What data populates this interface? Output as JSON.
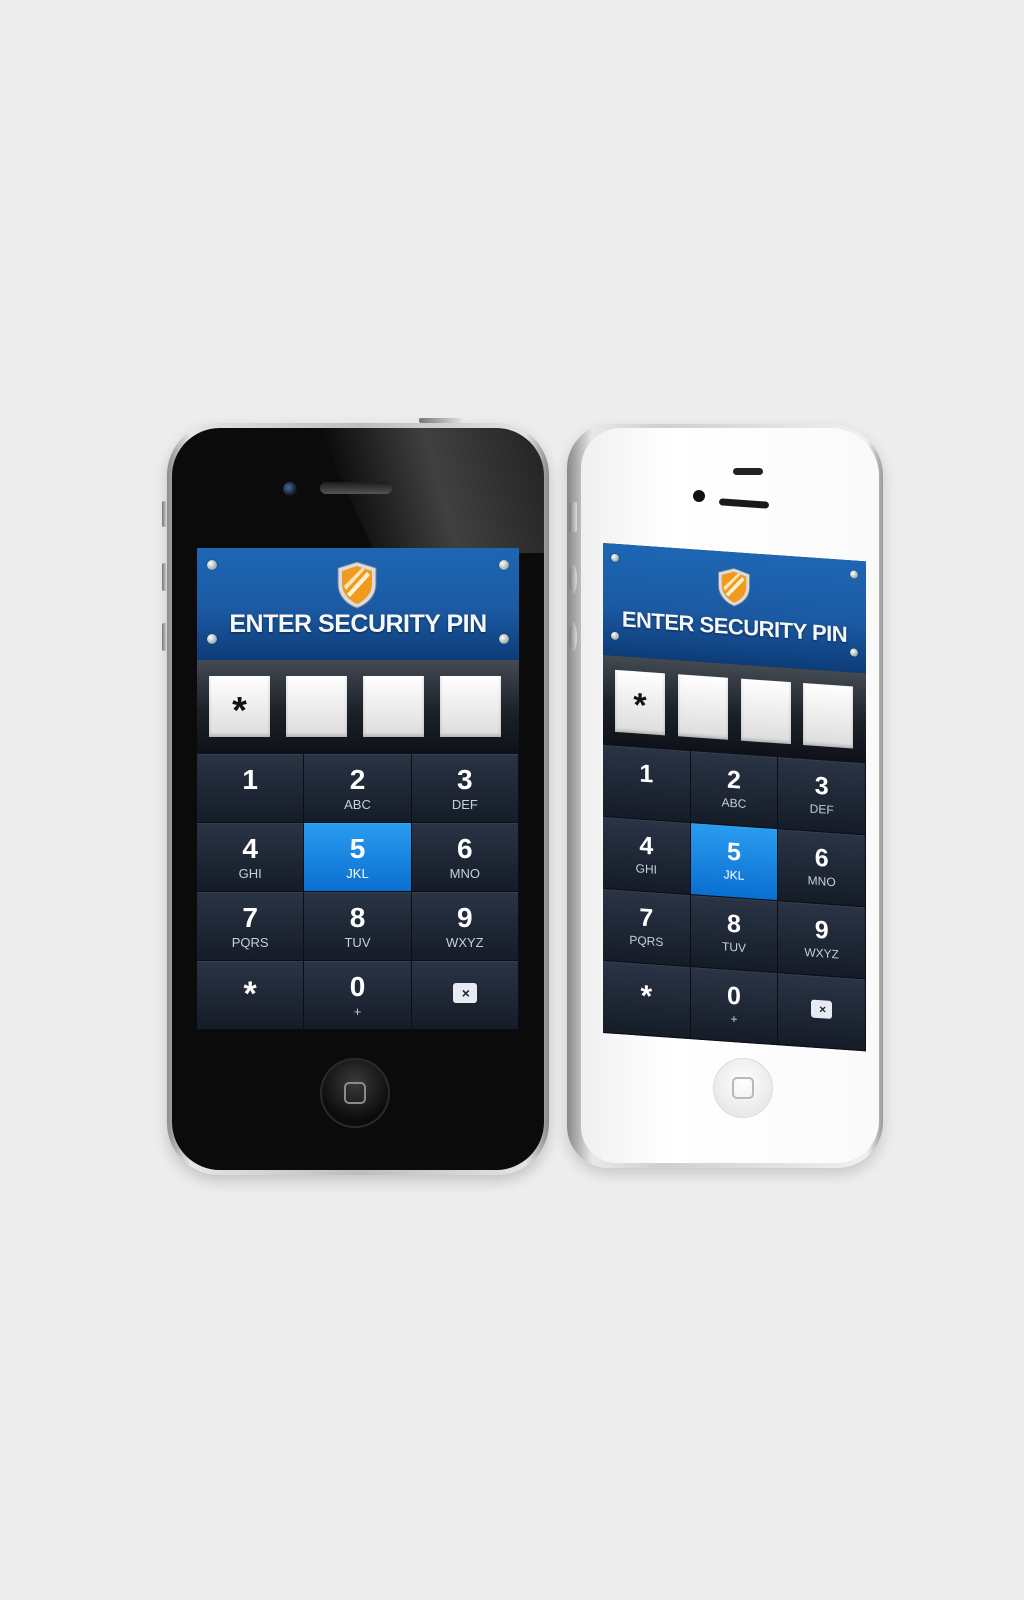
{
  "phones": [
    {
      "variant": "black",
      "screen": {
        "title": "ENTER SECURITY PIN",
        "pin_boxes": [
          "*",
          "",
          "",
          ""
        ],
        "keys": [
          {
            "num": "1",
            "sub": ""
          },
          {
            "num": "2",
            "sub": "ABC"
          },
          {
            "num": "3",
            "sub": "DEF"
          },
          {
            "num": "4",
            "sub": "GHI"
          },
          {
            "num": "5",
            "sub": "JKL",
            "active": true
          },
          {
            "num": "6",
            "sub": "MNO"
          },
          {
            "num": "7",
            "sub": "PQRS"
          },
          {
            "num": "8",
            "sub": "TUV"
          },
          {
            "num": "9",
            "sub": "WXYZ"
          },
          {
            "num": "*",
            "sub": ""
          },
          {
            "num": "0",
            "sub": "+"
          },
          {
            "num": "",
            "sub": "",
            "icon": "delete-icon",
            "glyph": "×"
          }
        ]
      }
    },
    {
      "variant": "white",
      "screen": {
        "title": "ENTER SECURITY PIN",
        "pin_boxes": [
          "*",
          "",
          "",
          ""
        ],
        "keys": [
          {
            "num": "1",
            "sub": ""
          },
          {
            "num": "2",
            "sub": "ABC"
          },
          {
            "num": "3",
            "sub": "DEF"
          },
          {
            "num": "4",
            "sub": "GHI"
          },
          {
            "num": "5",
            "sub": "JKL",
            "active": true
          },
          {
            "num": "6",
            "sub": "MNO"
          },
          {
            "num": "7",
            "sub": "PQRS"
          },
          {
            "num": "8",
            "sub": "TUV"
          },
          {
            "num": "9",
            "sub": "WXYZ"
          },
          {
            "num": "*",
            "sub": ""
          },
          {
            "num": "0",
            "sub": "+"
          },
          {
            "num": "",
            "sub": "",
            "icon": "delete-icon",
            "glyph": "×"
          }
        ]
      }
    }
  ],
  "colors": {
    "header_blue": "#1b5aa3",
    "active_key": "#0a6fd0",
    "shield_orange": "#f19a1e",
    "keypad_dark": "#151c28"
  }
}
